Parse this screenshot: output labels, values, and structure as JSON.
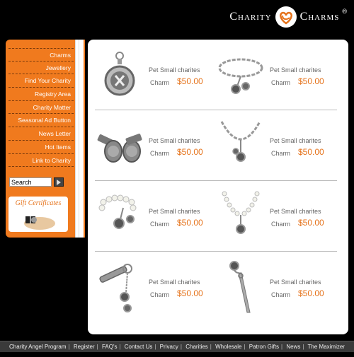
{
  "brand": {
    "left_word": "Charity",
    "right_word": "Charms",
    "reg": "®"
  },
  "sidebar": {
    "items": [
      {
        "label": "Charms"
      },
      {
        "label": "Jewellery"
      },
      {
        "label": "Find Your Charity"
      },
      {
        "label": "Registry Area"
      },
      {
        "label": "Charity Matter"
      },
      {
        "label": "Seasonal Ad Button"
      },
      {
        "label": "News Letter"
      },
      {
        "label": "Hot Items"
      },
      {
        "label": "Link to Charity"
      }
    ],
    "search_value": "Search",
    "gift_title": "Gift Certificates"
  },
  "products": [
    {
      "name": "Pet Small charites",
      "label": "Charm",
      "price": "$50.00",
      "icon": "charm-pendant"
    },
    {
      "name": "Pet Small charites",
      "label": "Charm",
      "price": "$50.00",
      "icon": "chain-bracelet"
    },
    {
      "name": "Pet Small charites",
      "label": "Charm",
      "price": "$50.00",
      "icon": "cufflinks"
    },
    {
      "name": "Pet Small charites",
      "label": "Charm",
      "price": "$50.00",
      "icon": "chain-necklace"
    },
    {
      "name": "Pet Small charites",
      "label": "Charm",
      "price": "$50.00",
      "icon": "pearl-bracelet"
    },
    {
      "name": "Pet Small charites",
      "label": "Charm",
      "price": "$50.00",
      "icon": "pearl-necklace"
    },
    {
      "name": "Pet Small charites",
      "label": "Charm",
      "price": "$50.00",
      "icon": "key-chain"
    },
    {
      "name": "Pet Small charites",
      "label": "Charm",
      "price": "$50.00",
      "icon": "bookmark"
    }
  ],
  "footer": {
    "links": [
      "Charity Angel Program",
      "Register",
      "FAQ's",
      "Contact Us",
      "Privacy",
      "Charities",
      "Wholesale",
      "Patron Gifts",
      "News",
      "The Maximizer"
    ]
  },
  "colors": {
    "accent": "#e5721a",
    "sidebar": "#f07a1e",
    "background": "#000000"
  }
}
